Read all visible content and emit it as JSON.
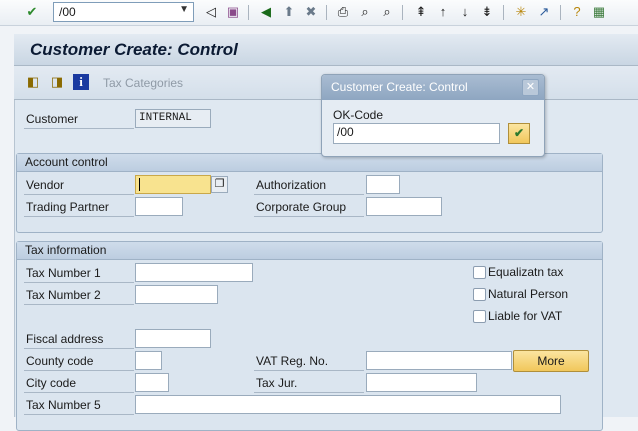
{
  "system_toolbar": {
    "command_field": "/00",
    "icons": [
      "enter-icon",
      "back-icon",
      "save-icon",
      "green-back-icon",
      "exit-icon",
      "cancel-icon",
      "print-icon",
      "find-icon",
      "find-next-icon",
      "first-page-icon",
      "previous-page-icon",
      "next-page-icon",
      "last-page-icon",
      "create-session-icon",
      "shortcut-icon",
      "help-icon",
      "customize-layout-icon"
    ]
  },
  "title": "Customer Create: Control",
  "app_toolbar": {
    "tax_categories": "Tax Categories"
  },
  "customer": {
    "label": "Customer",
    "value": "INTERNAL"
  },
  "account_control": {
    "header": "Account control",
    "vendor": "Vendor",
    "authorization": "Authorization",
    "trading_partner": "Trading Partner",
    "corporate_group": "Corporate Group"
  },
  "tax_information": {
    "header": "Tax information",
    "tax_number_1": "Tax Number 1",
    "tax_number_2": "Tax Number 2",
    "fiscal_address": "Fiscal address",
    "county_code": "County code",
    "city_code": "City code",
    "tax_number_5": "Tax Number 5",
    "vat_reg_no": "VAT Reg. No.",
    "tax_jur": "Tax Jur.",
    "equalizatn_tax": "Equalizatn tax",
    "natural_person": "Natural Person",
    "liable_for_vat": "Liable for VAT",
    "more": "More"
  },
  "dialog": {
    "title": "Customer Create: Control",
    "ok_code_label": "OK-Code",
    "ok_code_value": "/00"
  }
}
